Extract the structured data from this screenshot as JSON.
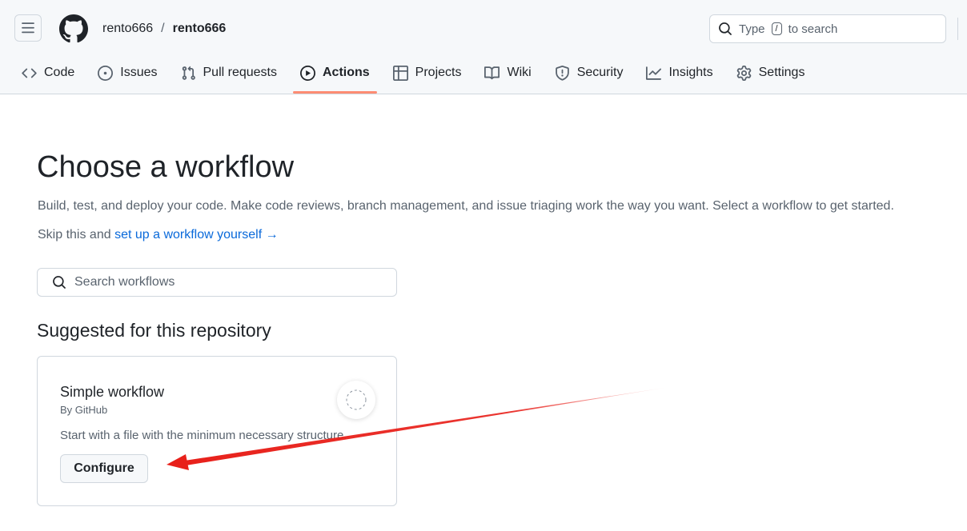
{
  "header": {
    "owner": "rento666",
    "separator": "/",
    "repo": "rento666",
    "search": {
      "prefix": "Type",
      "key": "/",
      "suffix": "to search"
    }
  },
  "tabs": [
    {
      "label": "Code",
      "icon": "code-icon",
      "active": false
    },
    {
      "label": "Issues",
      "icon": "issue-opened-icon",
      "active": false
    },
    {
      "label": "Pull requests",
      "icon": "git-pull-request-icon",
      "active": false
    },
    {
      "label": "Actions",
      "icon": "play-icon",
      "active": true
    },
    {
      "label": "Projects",
      "icon": "table-icon",
      "active": false
    },
    {
      "label": "Wiki",
      "icon": "book-icon",
      "active": false
    },
    {
      "label": "Security",
      "icon": "shield-icon",
      "active": false
    },
    {
      "label": "Insights",
      "icon": "graph-icon",
      "active": false
    },
    {
      "label": "Settings",
      "icon": "gear-icon",
      "active": false
    }
  ],
  "main": {
    "title": "Choose a workflow",
    "description": "Build, test, and deploy your code. Make code reviews, branch management, and issue triaging work the way you want. Select a workflow to get started.",
    "skip_prefix": "Skip this and ",
    "skip_link": "set up a workflow yourself",
    "skip_arrow": "→",
    "search_placeholder": "Search workflows",
    "suggested_heading": "Suggested for this repository",
    "card": {
      "title": "Simple workflow",
      "by": "By GitHub",
      "description": "Start with a file with the minimum necessary structure.",
      "button": "Configure"
    }
  },
  "colors": {
    "accent_underline": "#fd8c73",
    "link": "#0969da",
    "annotation_arrow": "#e8201a"
  }
}
